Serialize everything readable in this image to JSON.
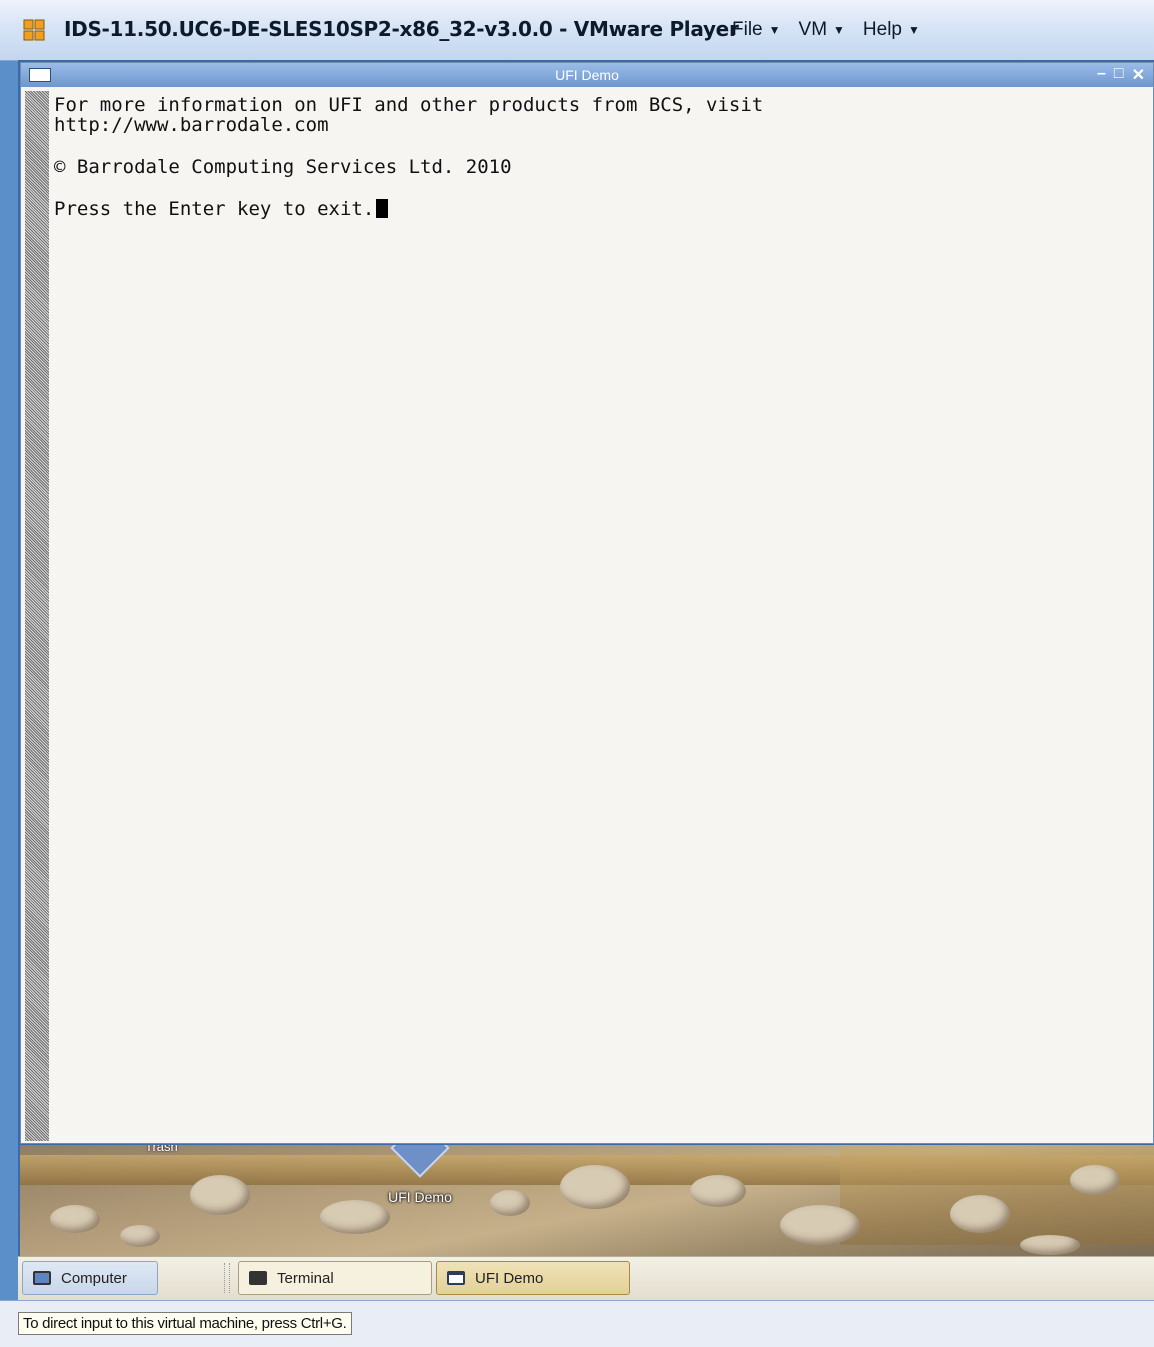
{
  "vm": {
    "title": "IDS-11.50.UC6-DE-SLES10SP2-x86_32-v3.0.0 - VMware Player",
    "menu": [
      {
        "label": "File",
        "mnemonic": "F"
      },
      {
        "label": "VM",
        "mnemonic": "V"
      },
      {
        "label": "Help",
        "mnemonic": "H"
      }
    ],
    "status": "To direct input to this virtual machine, press Ctrl+G."
  },
  "ufi_window": {
    "title": "UFI Demo",
    "lines": [
      "For more information on UFI and other products from BCS, visit",
      "http://www.barrodale.com",
      "© Barrodale Computing Services Ltd. 2010",
      "Press the Enter key to exit."
    ]
  },
  "desktop": {
    "icon_label": "UFI Demo",
    "cut_label": "Trash"
  },
  "taskbar": {
    "computer": "Computer",
    "items": [
      "Terminal",
      "UFI Demo"
    ]
  },
  "icons": {
    "vm_app": "vmware-icon",
    "window_menu": "window-menu-icon",
    "minimize": "minimize-icon",
    "maximize": "maximize-icon",
    "close": "close-icon",
    "computer": "computer-icon",
    "terminal": "terminal-icon",
    "window": "window-icon",
    "desktop_app": "ufi-demo-icon"
  },
  "colors": {
    "titlebar_text": "#0d1a2b",
    "window_bg": "#f7f5f1",
    "window_titlebar": "#7aa2d6"
  }
}
